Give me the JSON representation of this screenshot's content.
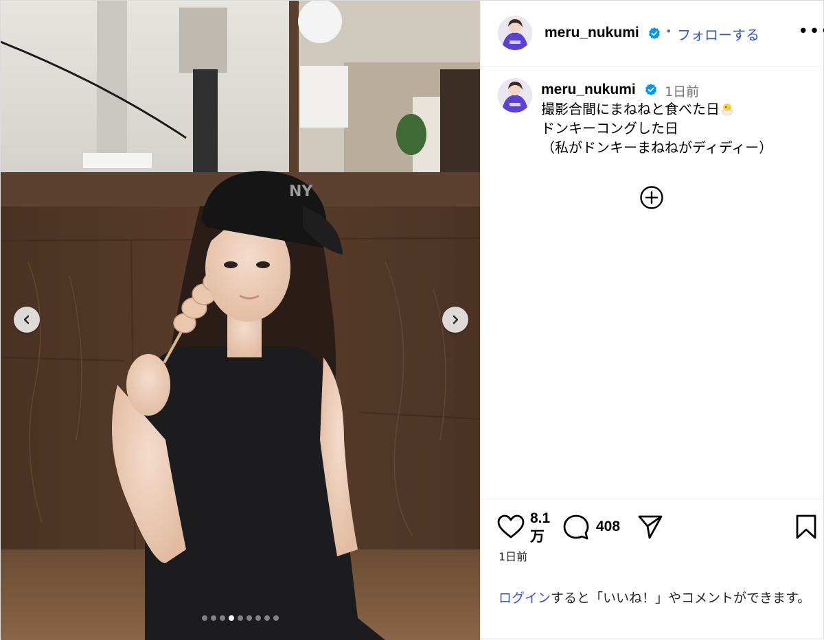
{
  "media": {
    "prev_icon": "chevron-left-icon",
    "next_icon": "chevron-right-icon",
    "carousel": {
      "total": 9,
      "current": 4
    }
  },
  "header": {
    "username": "meru_nukumi",
    "verified_icon": "verified-badge-icon",
    "separator": "•",
    "follow_label": "フォローする",
    "more_label": "•••"
  },
  "caption": {
    "username": "meru_nukumi",
    "time": "1日前",
    "lines": [
      "撮影合間にまねねと食べた日",
      "ドンキーコングした日",
      "（私がドンキーまねねがディディー）"
    ],
    "emoji_icon": "hatching-chick-icon",
    "more_comments_icon": "plus-circle-icon"
  },
  "actions": {
    "likes": "8.1万",
    "comments": "408",
    "time": "1日前",
    "login_link": "ログイン",
    "login_rest": "すると「いいね！」やコメントができます。"
  },
  "colors": {
    "link_blue": "#3451d1",
    "verified_blue": "#0095f6",
    "muted": "#737373"
  }
}
